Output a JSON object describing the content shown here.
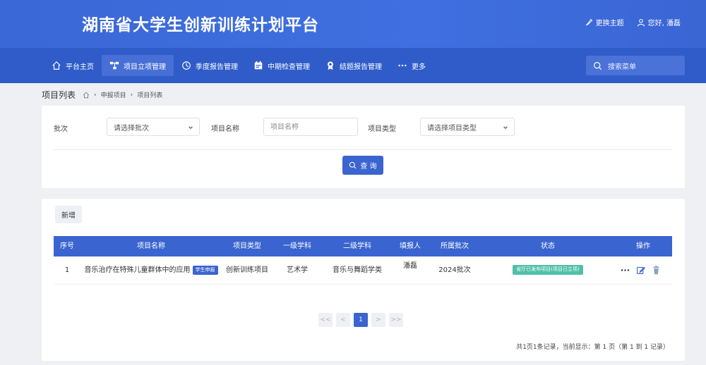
{
  "header": {
    "title": "湖南省大学生创新训练计划平台",
    "theme_label": "更换主题",
    "greeting": "您好, 潘磊"
  },
  "nav": {
    "items": [
      {
        "label": "平台主页",
        "icon": "home-icon"
      },
      {
        "label": "项目立项管理",
        "icon": "hierarchy-icon",
        "active": true
      },
      {
        "label": "季度报告管理",
        "icon": "clock-icon"
      },
      {
        "label": "中期检查管理",
        "icon": "calendar-icon"
      },
      {
        "label": "结题报告管理",
        "icon": "award-icon"
      },
      {
        "label": "更多",
        "icon": "more-icon"
      }
    ],
    "search_placeholder": "搜索菜单"
  },
  "breadcrumb": {
    "page_title": "项目列表",
    "items": [
      "申报项目",
      "项目列表"
    ]
  },
  "filters": {
    "batch_label": "批次",
    "batch_value": "请选择批次",
    "name_label": "项目名称",
    "name_placeholder": "项目名称",
    "type_label": "项目类型",
    "type_value": "请选择项目类型",
    "query_label": "查 询"
  },
  "table": {
    "add_label": "新增",
    "columns": [
      "序号",
      "项目名称",
      "项目类型",
      "一级学科",
      "二级学科",
      "填报人",
      "所属批次",
      "状态",
      "操作"
    ],
    "rows": [
      {
        "index": "1",
        "name": "音乐治疗在特殊儿童群体中的应用",
        "tag": "学生申报",
        "type": "创新训练项目",
        "discipline1": "艺术学",
        "discipline2": "音乐与舞蹈学类",
        "reporter": "潘磊",
        "batch": "2024批次",
        "status": "省厅已发布项目(项目已立项)"
      }
    ]
  },
  "pagination": {
    "first": "<<",
    "prev": "<",
    "current": "1",
    "next": ">",
    "last": ">>",
    "info": "共1页1条记录，当前显示：第 1 页（第 1 到 1 记录）"
  },
  "colors": {
    "header_bg": "#3a68d6",
    "nav_bg": "#2f5cc9",
    "accent": "#3a64cf",
    "status_green": "#4fc0a8"
  }
}
